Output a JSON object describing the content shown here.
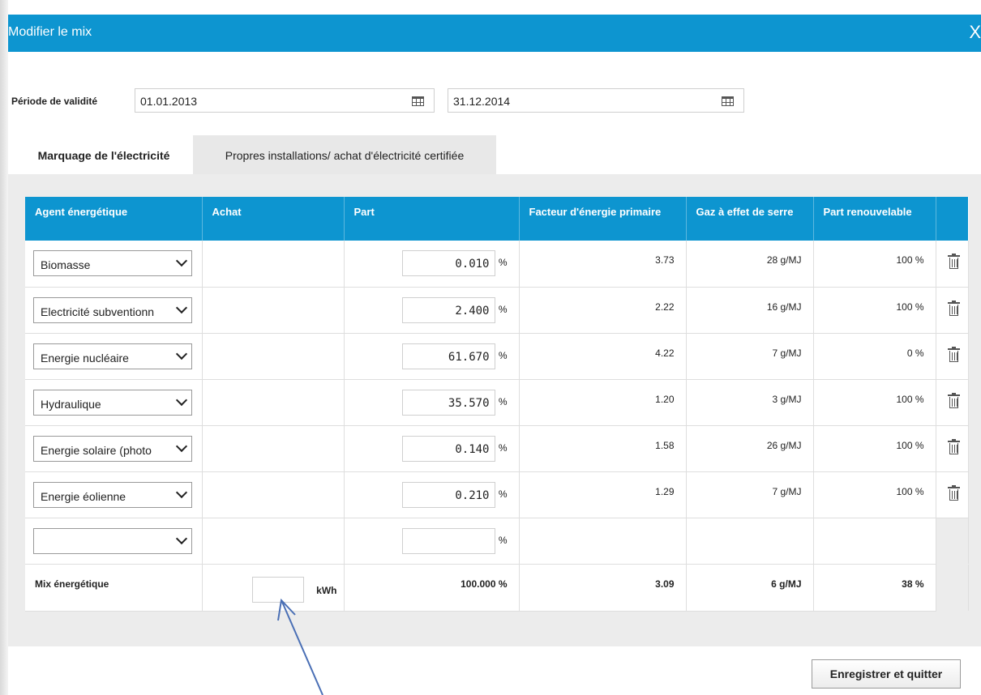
{
  "dialog": {
    "title": "Modifier le mix",
    "close_glyph": "X"
  },
  "period": {
    "label": "Période de validité",
    "start": "01.01.2013",
    "end": "31.12.2014",
    "calendar_icon": "calendar-icon"
  },
  "tabs": [
    {
      "label": "Marquage de l'électricité",
      "active": true
    },
    {
      "label": "Propres installations/ achat d'électricité certifiée",
      "active": false
    }
  ],
  "table": {
    "headers": {
      "agent": "Agent énergétique",
      "achat": "Achat",
      "part": "Part",
      "facteur": "Facteur d'énergie primaire",
      "gaz": "Gaz à effet de serre",
      "renouvelable": "Part renouvelable"
    },
    "rows": [
      {
        "agent": "Biomasse",
        "part": "0.010",
        "facteur": "3.73",
        "gaz": "28 g/MJ",
        "renouvelable": "100 %"
      },
      {
        "agent": "Electricité subventionn",
        "part": "2.400",
        "facteur": "2.22",
        "gaz": "16 g/MJ",
        "renouvelable": "100 %"
      },
      {
        "agent": "Energie nucléaire",
        "part": "61.670",
        "facteur": "4.22",
        "gaz": "7 g/MJ",
        "renouvelable": "0 %"
      },
      {
        "agent": "Hydraulique",
        "part": "35.570",
        "facteur": "1.20",
        "gaz": "3 g/MJ",
        "renouvelable": "100 %"
      },
      {
        "agent": "Energie solaire (photo",
        "part": "0.140",
        "facteur": "1.58",
        "gaz": "26 g/MJ",
        "renouvelable": "100 %"
      },
      {
        "agent": "Energie éolienne",
        "part": "0.210",
        "facteur": "1.29",
        "gaz": "7 g/MJ",
        "renouvelable": "100 %"
      }
    ],
    "empty_row": {
      "agent": "",
      "part": ""
    },
    "percent_unit": "%",
    "total": {
      "label": "Mix énergétique",
      "achat_value": "",
      "achat_unit": "kWh",
      "part": "100.000 %",
      "facteur": "3.09",
      "gaz": "6 g/MJ",
      "renouvelable": "38 %"
    }
  },
  "actions": {
    "save_label": "Enregistrer et quitter"
  },
  "colors": {
    "accent": "#0d95d0",
    "panel_bg": "#ececec",
    "annotation_arrow": "#4a6fb5"
  }
}
